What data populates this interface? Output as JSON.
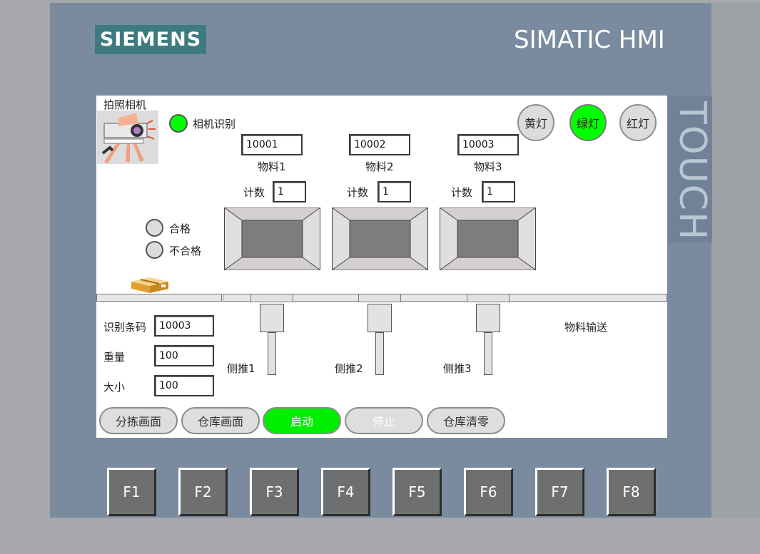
{
  "header": {
    "brand": "SIEMENS",
    "product": "SIMATIC HMI",
    "touch_label": "TOUCH"
  },
  "camera": {
    "title": "拍照相机",
    "recognition_label": "相机识别",
    "recognition_color": "#00e000"
  },
  "lights": {
    "yellow": "黄灯",
    "green": "绿灯",
    "red": "红灯",
    "green_color": "#00ff00"
  },
  "materials": [
    {
      "code": "10001",
      "label": "物料1",
      "count_label": "计数",
      "count": "1"
    },
    {
      "code": "10002",
      "label": "物料2",
      "count_label": "计数",
      "count": "1"
    },
    {
      "code": "10003",
      "label": "物料3",
      "count_label": "计数",
      "count": "1"
    }
  ],
  "quality": {
    "pass": "合格",
    "fail": "不合格"
  },
  "fields": {
    "barcode_label": "识别条码",
    "barcode": "10003",
    "weight_label": "重量",
    "weight": "100",
    "size_label": "大小",
    "size": "100"
  },
  "pushers": [
    "侧推1",
    "侧推2",
    "侧推3"
  ],
  "conveyor_label": "物料输送",
  "buttons": {
    "sort_screen": "分拣画面",
    "warehouse_screen": "仓库画面",
    "start": "启动",
    "stop": "停止",
    "warehouse_clear": "仓库清零",
    "start_color": "#00ee00"
  },
  "function_keys": [
    "F1",
    "F2",
    "F3",
    "F4",
    "F5",
    "F6",
    "F7",
    "F8"
  ]
}
